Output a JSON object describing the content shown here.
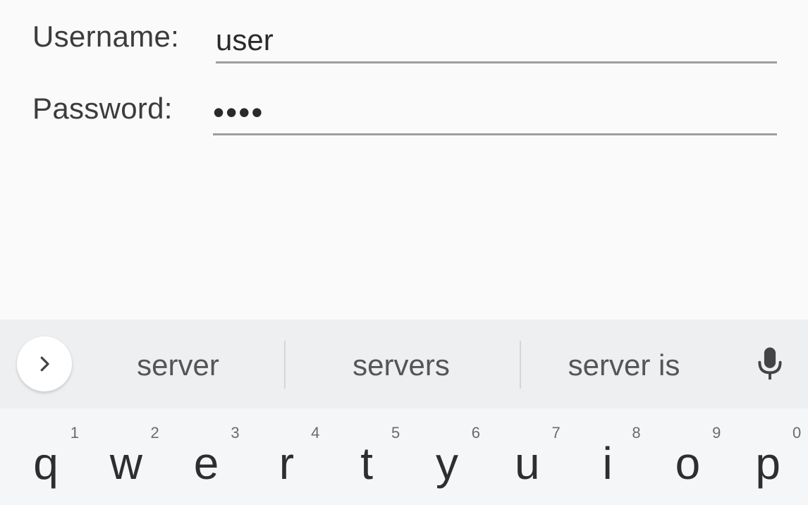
{
  "form": {
    "username_label": "Username:",
    "username_value": "user",
    "password_label": "Password:",
    "password_value": "••••"
  },
  "suggestions": {
    "items": [
      "server",
      "servers",
      "server is"
    ],
    "expand_icon": "chevron-right-icon",
    "mic_icon": "microphone-icon"
  },
  "keyboard": {
    "row1": [
      {
        "letter": "q",
        "hint": "1"
      },
      {
        "letter": "w",
        "hint": "2"
      },
      {
        "letter": "e",
        "hint": "3"
      },
      {
        "letter": "r",
        "hint": "4"
      },
      {
        "letter": "t",
        "hint": "5"
      },
      {
        "letter": "y",
        "hint": "6"
      },
      {
        "letter": "u",
        "hint": "7"
      },
      {
        "letter": "i",
        "hint": "8"
      },
      {
        "letter": "o",
        "hint": "9"
      },
      {
        "letter": "p",
        "hint": "0"
      }
    ]
  },
  "colors": {
    "background": "#fafafa",
    "suggestion_bar": "#eeeff1",
    "keyboard": "#f5f6f7",
    "underline": "#9e9e9e"
  }
}
